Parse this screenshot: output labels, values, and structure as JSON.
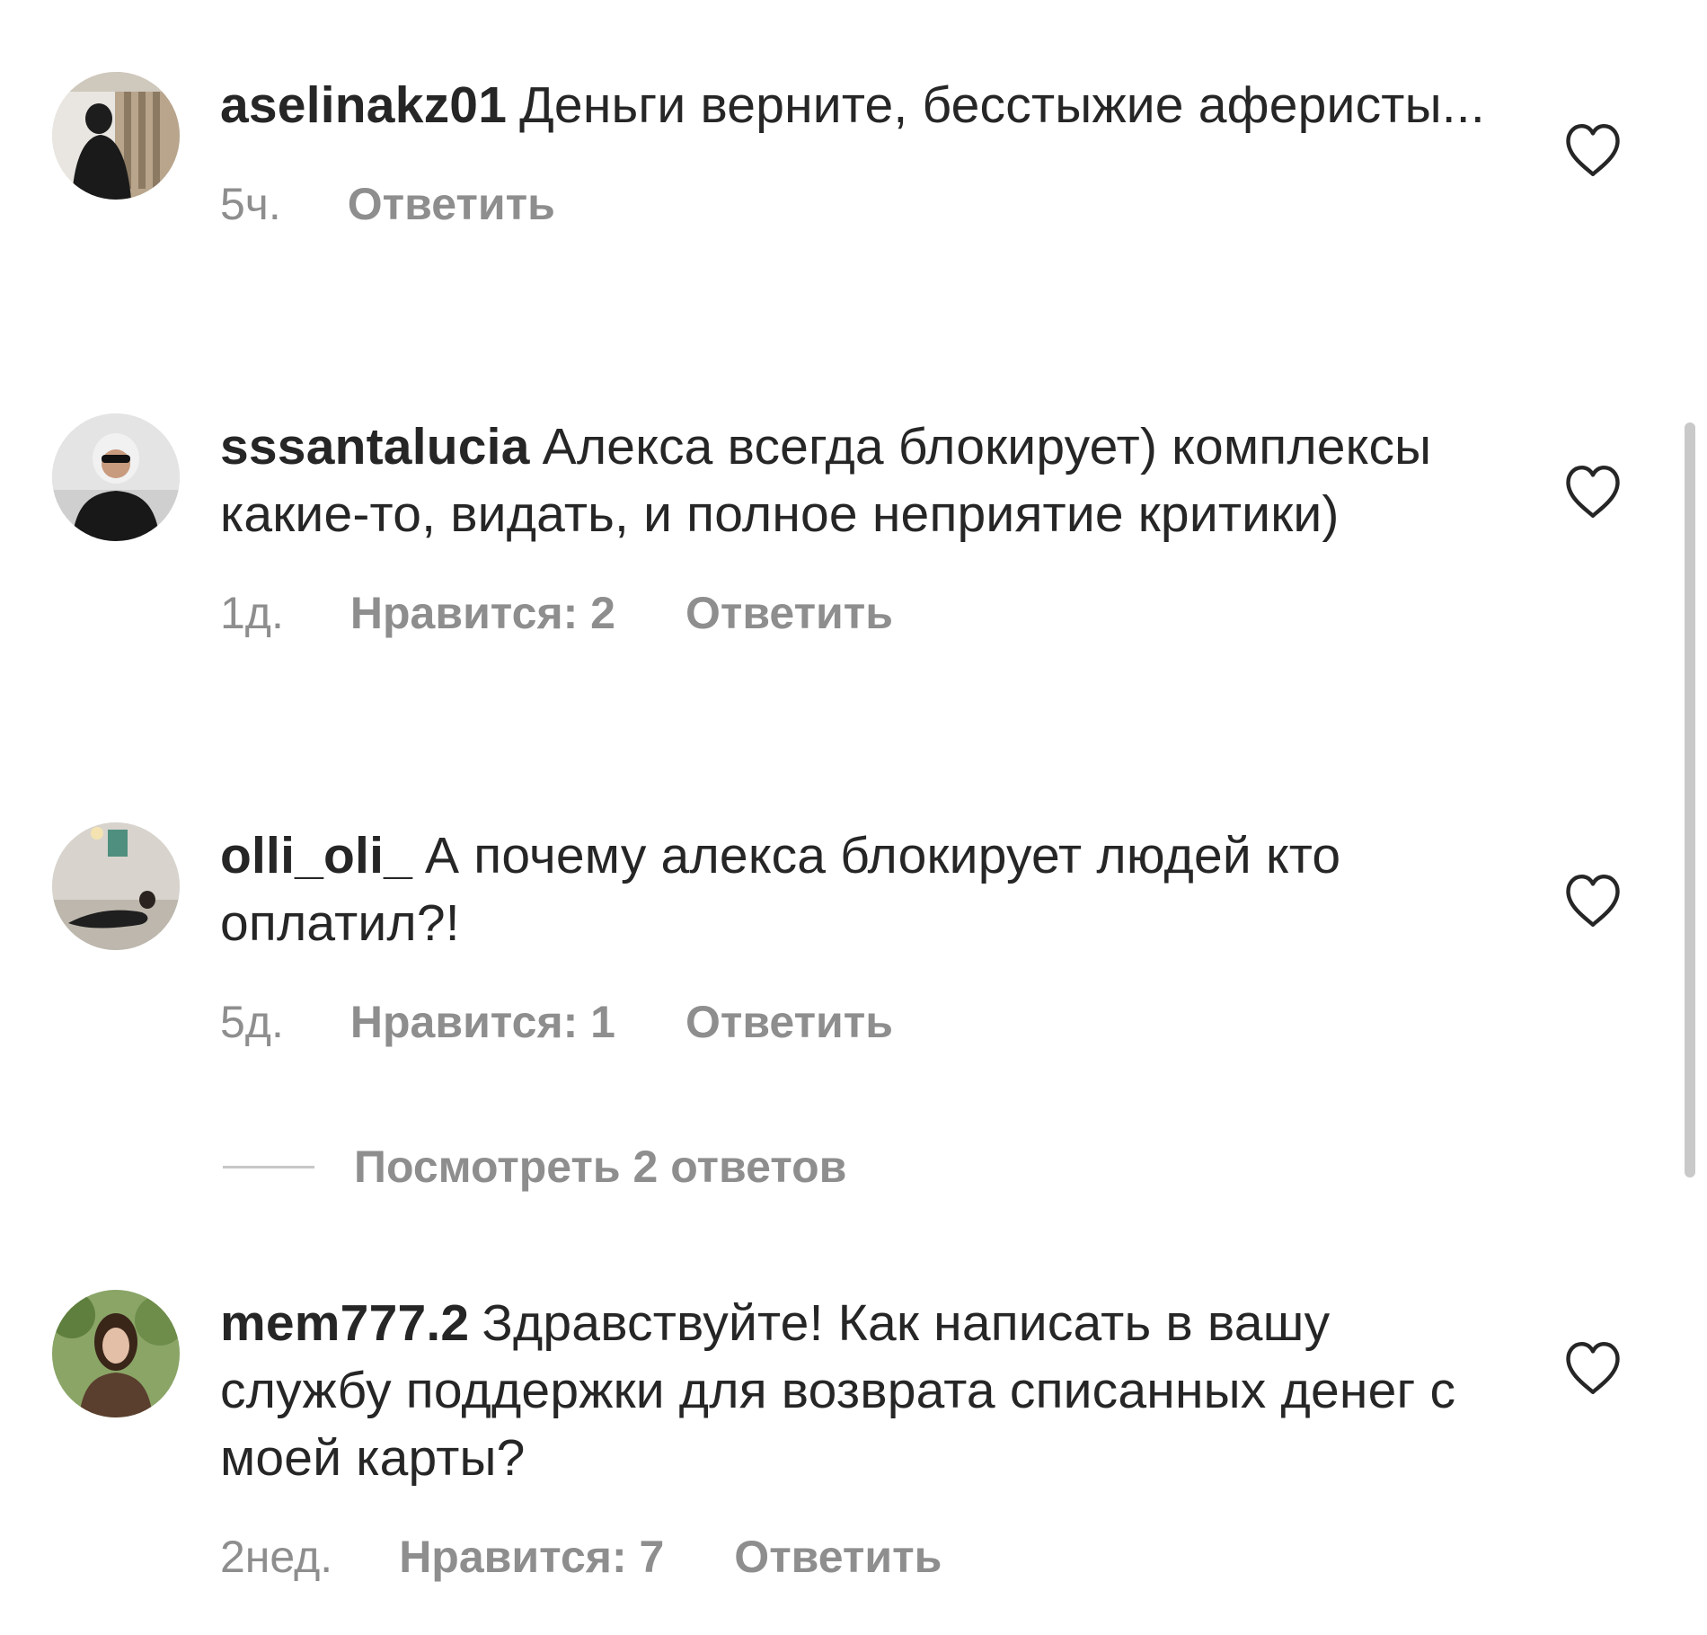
{
  "comments": [
    {
      "username": "aselinakz01",
      "text": "Деньги верните, бесстыжие аферисты...",
      "time": "5ч.",
      "likes": "",
      "reply": "Ответить"
    },
    {
      "username": "sssantalucia",
      "text": "Алекса всегда блокирует) комплексы какие-то, видать, и полное неприятие критики)",
      "time": "1д.",
      "likes": "Нравится: 2",
      "reply": "Ответить"
    },
    {
      "username": "olli_oli_",
      "text": "А почему алекса блокирует людей кто оплатил?!",
      "time": "5д.",
      "likes": "Нравится: 1",
      "reply": "Ответить"
    },
    {
      "username": "mem777.2",
      "text": "Здравствуйте! Как написать в вашу службу поддержки для возврата списанных денег с моей карты?",
      "time": "2нед.",
      "likes": "Нравится: 7",
      "reply": "Ответить"
    }
  ],
  "view_replies": "Посмотреть 2 ответов",
  "icons": {
    "like": "heart-outline-icon"
  },
  "colors": {
    "text": "#262626",
    "secondary": "#8e8e8e",
    "background": "#ffffff"
  }
}
